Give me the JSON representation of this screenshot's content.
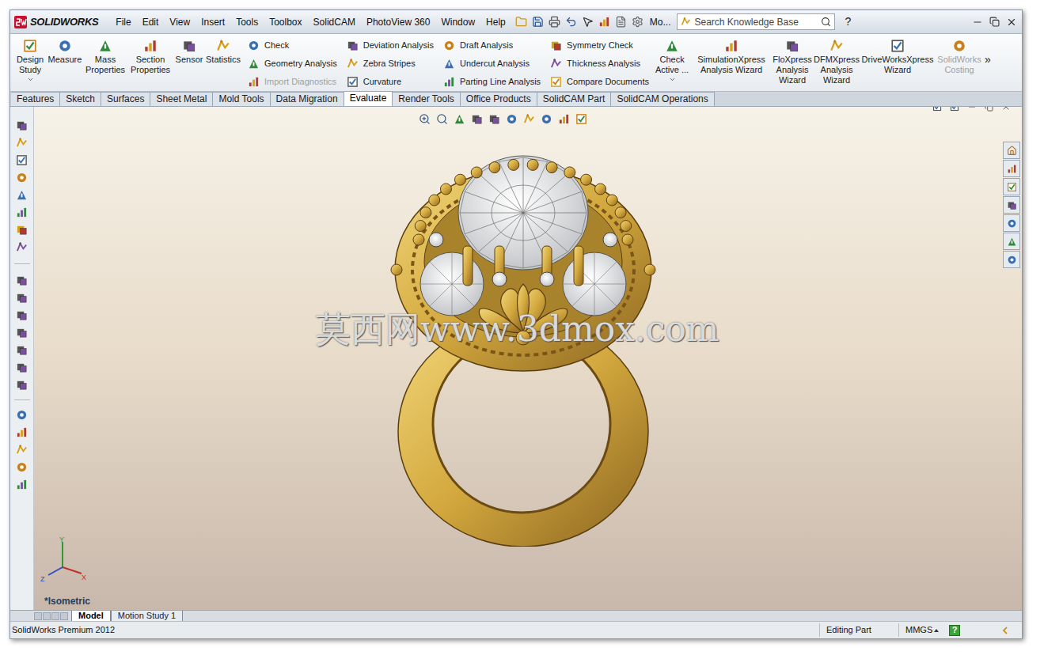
{
  "window": {
    "app": "SOLIDWORKS",
    "more": "Mo...",
    "help": "?"
  },
  "menus": [
    "File",
    "Edit",
    "View",
    "Insert",
    "Tools",
    "Toolbox",
    "SolidCAM",
    "PhotoView 360",
    "Window",
    "Help"
  ],
  "search": {
    "placeholder": "Search Knowledge Base"
  },
  "command_manager": {
    "large_left": [
      {
        "label": "Design Study",
        "disabled": false
      },
      {
        "label": "Measure",
        "disabled": false
      },
      {
        "label": "Mass Properties",
        "disabled": false
      },
      {
        "label": "Section Properties",
        "disabled": false
      },
      {
        "label": "Sensor",
        "disabled": false
      },
      {
        "label": "Statistics",
        "disabled": false
      }
    ],
    "small_columns": [
      [
        {
          "label": "Check",
          "disabled": false
        },
        {
          "label": "Geometry Analysis",
          "disabled": false
        },
        {
          "label": "Import Diagnostics",
          "disabled": true
        }
      ],
      [
        {
          "label": "Deviation Analysis",
          "disabled": false
        },
        {
          "label": "Zebra Stripes",
          "disabled": false
        },
        {
          "label": "Curvature",
          "disabled": false
        }
      ],
      [
        {
          "label": "Draft Analysis",
          "disabled": false
        },
        {
          "label": "Undercut Analysis",
          "disabled": false
        },
        {
          "label": "Parting Line Analysis",
          "disabled": false
        }
      ],
      [
        {
          "label": "Symmetry Check",
          "disabled": false
        },
        {
          "label": "Thickness Analysis",
          "disabled": false
        },
        {
          "label": "Compare Documents",
          "disabled": false
        }
      ]
    ],
    "large_right": [
      {
        "label": "Check Active ...",
        "disabled": false
      },
      {
        "label": "SimulationXpress Analysis Wizard",
        "disabled": false
      },
      {
        "label": "FloXpress Analysis Wizard",
        "disabled": false
      },
      {
        "label": "DFMXpress Analysis Wizard",
        "disabled": false
      },
      {
        "label": "DriveWorksXpress Wizard",
        "disabled": false
      },
      {
        "label": "SolidWorks Costing",
        "disabled": true
      }
    ],
    "overflow": "»"
  },
  "tabs": [
    {
      "label": "Features",
      "selected": false
    },
    {
      "label": "Sketch",
      "selected": false
    },
    {
      "label": "Surfaces",
      "selected": false
    },
    {
      "label": "Sheet Metal",
      "selected": false
    },
    {
      "label": "Mold Tools",
      "selected": false
    },
    {
      "label": "Data Migration",
      "selected": false
    },
    {
      "label": "Evaluate",
      "selected": true
    },
    {
      "label": "Render Tools",
      "selected": false
    },
    {
      "label": "Office Products",
      "selected": false
    },
    {
      "label": "SolidCAM Part",
      "selected": false
    },
    {
      "label": "SolidCAM Operations",
      "selected": false
    }
  ],
  "viewport": {
    "view_label": "*Isometric",
    "watermark": "莫西网www.3dmox.com",
    "axes": {
      "y": "Y",
      "x": "X",
      "z": "Z"
    }
  },
  "bottom_tabs": [
    {
      "label": "Model",
      "selected": true
    },
    {
      "label": "Motion Study 1",
      "selected": false
    }
  ],
  "status_bar": {
    "product": "SolidWorks Premium 2012",
    "mode": "Editing Part",
    "units": "MMGS",
    "help": "?"
  }
}
